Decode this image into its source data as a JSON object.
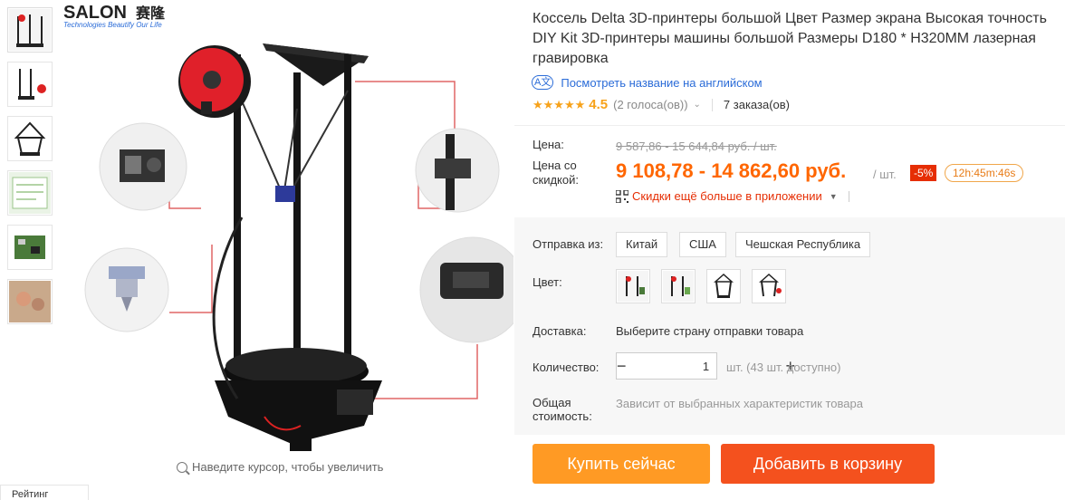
{
  "brand": {
    "logo_main": "SALON",
    "logo_cn": "赛隆",
    "logo_tagline": "Technologies Beautify Our Life"
  },
  "gallery": {
    "thumbnail_count": 6,
    "zoom_hint": "Наведите курсор, чтобы увеличить",
    "rating_tab": "Рейтинг"
  },
  "product": {
    "title": "Коссель Delta 3D-принтеры большой Цвет Размер экрана Высокая точность DIY Kit 3D-принтеры машины большой Размеры D180 * H320MM лазерная гравировка",
    "translate_link": "Посмотреть название на английском",
    "translate_icon": "A文",
    "stars": "★★★★★",
    "rating": "4.5",
    "votes": "(2 голоса(ов))",
    "orders": "7 заказа(ов)"
  },
  "price": {
    "label_price": "Цена:",
    "old_price": "9 587,86 - 15 644,84 руб. / шт.",
    "label_discount_price": "Цена со скидкой:",
    "new_price": "9 108,78 - 14 862,60 руб.",
    "unit": "/ шт.",
    "discount": "-5%",
    "timer": "12h:45m:46s",
    "app_promo": "Скидки ещё больше в приложении"
  },
  "options": {
    "ship_label": "Отправка из:",
    "ship_from": [
      "Китай",
      "США",
      "Чешская Республика"
    ],
    "color_label": "Цвет:",
    "color_count": 4,
    "delivery_label": "Доставка:",
    "delivery_value": "Выберите страну отправки товара",
    "qty_label": "Количество:",
    "qty_value": "1",
    "qty_available": "шт. (43 шт. доступно)",
    "total_label": "Общая стоимость:",
    "total_value": "Зависит от выбранных характеристик товара"
  },
  "actions": {
    "buy_now": "Купить сейчас",
    "add_to_cart": "Добавить в корзину"
  },
  "colors": {
    "price_orange": "#ff6600",
    "buy_button": "#ff9a24",
    "cart_button": "#f4511e",
    "discount_badge": "#e62e04",
    "link_blue": "#2b6cd8",
    "printer_frame": "#1a1a1a",
    "filament_red": "#e0202a",
    "callout_line": "#e06666"
  }
}
